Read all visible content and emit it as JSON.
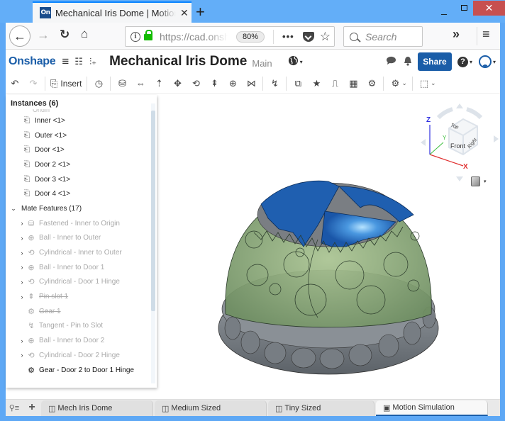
{
  "browser": {
    "tab_title": "Mechanical Iris Dome | Motion Simulation",
    "tab_favicon": "On",
    "url": "https://cad.onshape.com",
    "zoom": "80%",
    "search_placeholder": "Search",
    "icons": {
      "back": "←",
      "forward": "→",
      "reload": "↻",
      "home": "⌂",
      "close": "✕",
      "new_tab": "+",
      "more": "•••",
      "star": "☆",
      "overflow": "»",
      "menu": "≡",
      "minimize": "_",
      "window_close": "✕",
      "info": "i"
    }
  },
  "app": {
    "logo": "Onshape",
    "document_title": "Mechanical Iris Dome",
    "branch": "Main",
    "share_label": "Share",
    "help_label": "?",
    "icons": {
      "hamburger": "≡",
      "feature_list": "☷",
      "insert_part": "⫶₊",
      "globe": "🌐",
      "caret": "▾",
      "comment": "💬",
      "bell": "🔔"
    }
  },
  "toolbar": {
    "undo": "↶",
    "redo": "↷",
    "insert_label": "Insert",
    "insert_icon": "⎘",
    "mate_icons": [
      "◷",
      "⛁",
      "⇔",
      "⇡",
      "✥",
      "⟲",
      "⇞",
      "⊕",
      "⋈",
      "↯",
      "⧉",
      "★",
      "⎍",
      "▦",
      "⚙",
      "⚙",
      "⬚"
    ],
    "dropdown": "⌄"
  },
  "instances_panel": {
    "title": "Instances (6)",
    "origin_fragment": "Origin",
    "instances": [
      {
        "label": "Inner <1>",
        "icon": "⎗"
      },
      {
        "label": "Outer <1>",
        "icon": "⎗"
      },
      {
        "label": "Door <1>",
        "icon": "⎗"
      },
      {
        "label": "Door 2 <1>",
        "icon": "⎗"
      },
      {
        "label": "Door 3 <1>",
        "icon": "⎗"
      },
      {
        "label": "Door 4 <1>",
        "icon": "⎗"
      }
    ],
    "mate_group": {
      "label": "Mate Features (17)",
      "chevron": "⌄"
    },
    "mates": [
      {
        "label": "Fastened - Inner to Origin",
        "icon": "⛁",
        "expandable": true,
        "state": "suppressed"
      },
      {
        "label": "Ball - Inner to Outer",
        "icon": "⊕",
        "expandable": true,
        "state": "suppressed"
      },
      {
        "label": "Cylindrical - Inner to Outer",
        "icon": "⟲",
        "expandable": true,
        "state": "suppressed"
      },
      {
        "label": "Ball - Inner to Door 1",
        "icon": "⊕",
        "expandable": true,
        "state": "suppressed"
      },
      {
        "label": "Cylindrical - Door 1 Hinge",
        "icon": "⟲",
        "expandable": true,
        "state": "suppressed"
      },
      {
        "label": "Pin slot 1",
        "icon": "⇞",
        "expandable": true,
        "state": "struck"
      },
      {
        "label": "Gear 1",
        "icon": "⚙",
        "expandable": false,
        "state": "struck"
      },
      {
        "label": "Tangent - Pin to Slot",
        "icon": "↯",
        "expandable": false,
        "state": "suppressed"
      },
      {
        "label": "Ball - Inner to Door 2",
        "icon": "⊕",
        "expandable": true,
        "state": "suppressed"
      },
      {
        "label": "Cylindrical - Door 2 Hinge",
        "icon": "⟲",
        "expandable": true,
        "state": "suppressed"
      },
      {
        "label": "Gear - Door 2 to Door 1 Hinge",
        "icon": "⚙",
        "expandable": false,
        "state": "active"
      }
    ],
    "expand_chevron": "›"
  },
  "view_cube": {
    "faces": {
      "top": "Top",
      "front": "Front",
      "right": "Right"
    },
    "axes": {
      "x": "X",
      "y": "Y",
      "z": "Z"
    },
    "axis_colors": {
      "x": "#e03030",
      "y": "#40c040",
      "z": "#3030e0"
    }
  },
  "model": {
    "colors": {
      "shell": "#8fb07e",
      "doors": "#1f5fb0",
      "doors_highlight": "#6fb8f0",
      "base": "#7d838a",
      "inside": "#7a7e83"
    }
  },
  "bottom_tabs": {
    "filter_icon": "⚲≡",
    "add_icon": "+",
    "tabs": [
      {
        "label": "Mech Iris Dome",
        "icon": "◫",
        "active": false
      },
      {
        "label": "Medium Sized",
        "icon": "◫",
        "active": false
      },
      {
        "label": "Tiny Sized",
        "icon": "◫",
        "active": false
      },
      {
        "label": "Motion Simulation",
        "icon": "▣",
        "active": true
      }
    ]
  }
}
